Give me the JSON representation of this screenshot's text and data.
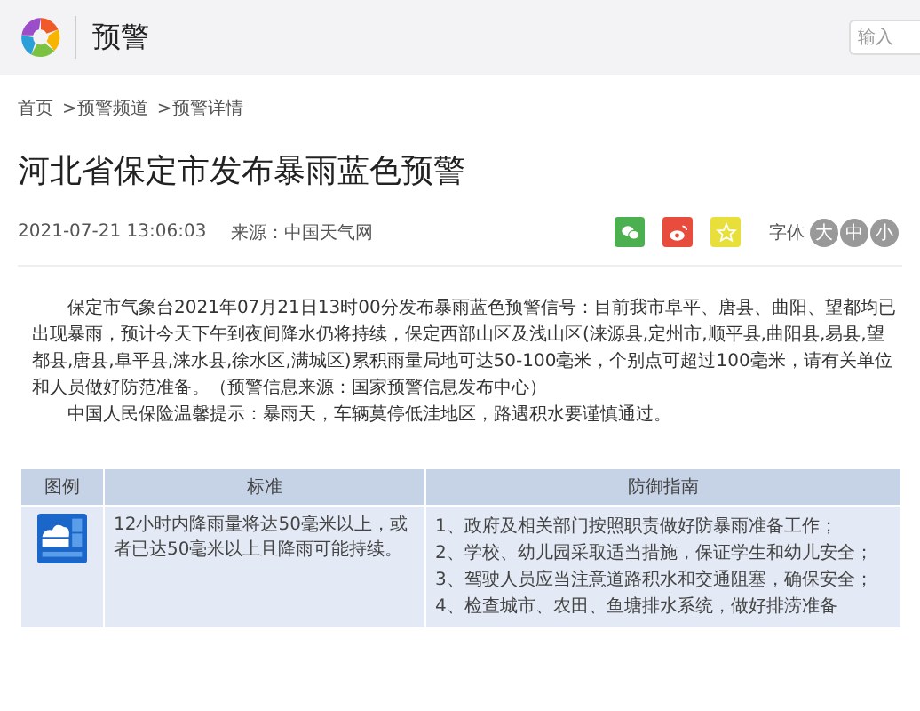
{
  "header": {
    "title": "预警",
    "search": {
      "placeholder": "输入"
    }
  },
  "breadcrumb": [
    "首页",
    ">预警频道",
    ">预警详情"
  ],
  "article": {
    "title": "河北省保定市发布暴雨蓝色预警",
    "date": "2021-07-21 13:06:03",
    "source_label": "来源：",
    "source": "中国天气网",
    "font_label": "字体",
    "font_sizes": [
      {
        "label": "大",
        "selected": false
      },
      {
        "label": "中",
        "selected": false
      },
      {
        "label": "小",
        "selected": false
      }
    ],
    "paragraphs": [
      "保定市气象台2021年07月21日13时00分发布暴雨蓝色预警信号：目前我市阜平、唐县、曲阳、望都均已出现暴雨，预计今天下午到夜间降水仍将持续，保定西部山区及浅山区(涞源县,定州市,顺平县,曲阳县,易县,望都县,唐县,阜平县,涞水县,徐水区,满城区)累积雨量局地可达50-100毫米，个别点可超过100毫米，请有关单位和人员做好防范准备。（预警信息来源：国家预警信息发布中心）",
      "中国人民保险温馨提示：暴雨天，车辆莫停低洼地区，路遇积水要谨慎通过。"
    ]
  },
  "table": {
    "columns": [
      "图例",
      "标准",
      "防御指南"
    ],
    "rows": [
      {
        "standard": "12小时内降雨量将达50毫米以上，或者已达50毫米以上且降雨可能持续。",
        "guide": [
          "1、政府及相关部门按照职责做好防暴雨准备工作；",
          "2、学校、幼儿园采取适当措施，保证学生和幼儿安全；",
          "3、驾驶人员应当注意道路积水和交通阻塞，确保安全；",
          "4、检查城市、农田、鱼塘排水系统，做好排涝准备"
        ]
      }
    ]
  }
}
